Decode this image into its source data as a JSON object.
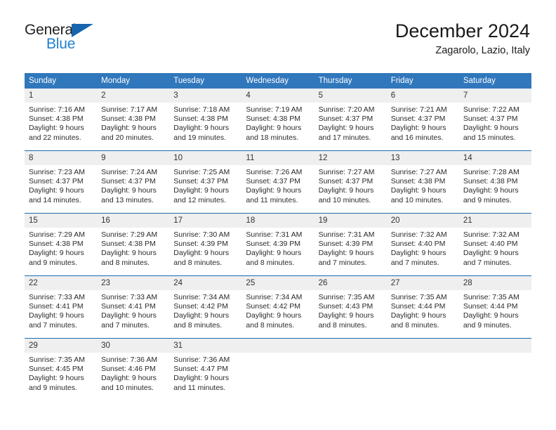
{
  "brand": {
    "name_primary": "General",
    "name_secondary": "Blue"
  },
  "header": {
    "title": "December 2024",
    "subtitle": "Zagarolo, Lazio, Italy"
  },
  "colors": {
    "header_blue": "#3077bc",
    "rule_blue": "#1c6cb0",
    "daynum_gray": "#efefef",
    "logo_blue": "#1f7fd0",
    "logo_triangle": "#1665ae"
  },
  "calendar": {
    "weekday_headers": [
      "Sunday",
      "Monday",
      "Tuesday",
      "Wednesday",
      "Thursday",
      "Friday",
      "Saturday"
    ],
    "weeks": [
      [
        {
          "day": "1",
          "sunrise": "Sunrise: 7:16 AM",
          "sunset": "Sunset: 4:38 PM",
          "daylight_line1": "Daylight: 9 hours",
          "daylight_line2": "and 22 minutes."
        },
        {
          "day": "2",
          "sunrise": "Sunrise: 7:17 AM",
          "sunset": "Sunset: 4:38 PM",
          "daylight_line1": "Daylight: 9 hours",
          "daylight_line2": "and 20 minutes."
        },
        {
          "day": "3",
          "sunrise": "Sunrise: 7:18 AM",
          "sunset": "Sunset: 4:38 PM",
          "daylight_line1": "Daylight: 9 hours",
          "daylight_line2": "and 19 minutes."
        },
        {
          "day": "4",
          "sunrise": "Sunrise: 7:19 AM",
          "sunset": "Sunset: 4:38 PM",
          "daylight_line1": "Daylight: 9 hours",
          "daylight_line2": "and 18 minutes."
        },
        {
          "day": "5",
          "sunrise": "Sunrise: 7:20 AM",
          "sunset": "Sunset: 4:37 PM",
          "daylight_line1": "Daylight: 9 hours",
          "daylight_line2": "and 17 minutes."
        },
        {
          "day": "6",
          "sunrise": "Sunrise: 7:21 AM",
          "sunset": "Sunset: 4:37 PM",
          "daylight_line1": "Daylight: 9 hours",
          "daylight_line2": "and 16 minutes."
        },
        {
          "day": "7",
          "sunrise": "Sunrise: 7:22 AM",
          "sunset": "Sunset: 4:37 PM",
          "daylight_line1": "Daylight: 9 hours",
          "daylight_line2": "and 15 minutes."
        }
      ],
      [
        {
          "day": "8",
          "sunrise": "Sunrise: 7:23 AM",
          "sunset": "Sunset: 4:37 PM",
          "daylight_line1": "Daylight: 9 hours",
          "daylight_line2": "and 14 minutes."
        },
        {
          "day": "9",
          "sunrise": "Sunrise: 7:24 AM",
          "sunset": "Sunset: 4:37 PM",
          "daylight_line1": "Daylight: 9 hours",
          "daylight_line2": "and 13 minutes."
        },
        {
          "day": "10",
          "sunrise": "Sunrise: 7:25 AM",
          "sunset": "Sunset: 4:37 PM",
          "daylight_line1": "Daylight: 9 hours",
          "daylight_line2": "and 12 minutes."
        },
        {
          "day": "11",
          "sunrise": "Sunrise: 7:26 AM",
          "sunset": "Sunset: 4:37 PM",
          "daylight_line1": "Daylight: 9 hours",
          "daylight_line2": "and 11 minutes."
        },
        {
          "day": "12",
          "sunrise": "Sunrise: 7:27 AM",
          "sunset": "Sunset: 4:37 PM",
          "daylight_line1": "Daylight: 9 hours",
          "daylight_line2": "and 10 minutes."
        },
        {
          "day": "13",
          "sunrise": "Sunrise: 7:27 AM",
          "sunset": "Sunset: 4:38 PM",
          "daylight_line1": "Daylight: 9 hours",
          "daylight_line2": "and 10 minutes."
        },
        {
          "day": "14",
          "sunrise": "Sunrise: 7:28 AM",
          "sunset": "Sunset: 4:38 PM",
          "daylight_line1": "Daylight: 9 hours",
          "daylight_line2": "and 9 minutes."
        }
      ],
      [
        {
          "day": "15",
          "sunrise": "Sunrise: 7:29 AM",
          "sunset": "Sunset: 4:38 PM",
          "daylight_line1": "Daylight: 9 hours",
          "daylight_line2": "and 9 minutes."
        },
        {
          "day": "16",
          "sunrise": "Sunrise: 7:29 AM",
          "sunset": "Sunset: 4:38 PM",
          "daylight_line1": "Daylight: 9 hours",
          "daylight_line2": "and 8 minutes."
        },
        {
          "day": "17",
          "sunrise": "Sunrise: 7:30 AM",
          "sunset": "Sunset: 4:39 PM",
          "daylight_line1": "Daylight: 9 hours",
          "daylight_line2": "and 8 minutes."
        },
        {
          "day": "18",
          "sunrise": "Sunrise: 7:31 AM",
          "sunset": "Sunset: 4:39 PM",
          "daylight_line1": "Daylight: 9 hours",
          "daylight_line2": "and 8 minutes."
        },
        {
          "day": "19",
          "sunrise": "Sunrise: 7:31 AM",
          "sunset": "Sunset: 4:39 PM",
          "daylight_line1": "Daylight: 9 hours",
          "daylight_line2": "and 7 minutes."
        },
        {
          "day": "20",
          "sunrise": "Sunrise: 7:32 AM",
          "sunset": "Sunset: 4:40 PM",
          "daylight_line1": "Daylight: 9 hours",
          "daylight_line2": "and 7 minutes."
        },
        {
          "day": "21",
          "sunrise": "Sunrise: 7:32 AM",
          "sunset": "Sunset: 4:40 PM",
          "daylight_line1": "Daylight: 9 hours",
          "daylight_line2": "and 7 minutes."
        }
      ],
      [
        {
          "day": "22",
          "sunrise": "Sunrise: 7:33 AM",
          "sunset": "Sunset: 4:41 PM",
          "daylight_line1": "Daylight: 9 hours",
          "daylight_line2": "and 7 minutes."
        },
        {
          "day": "23",
          "sunrise": "Sunrise: 7:33 AM",
          "sunset": "Sunset: 4:41 PM",
          "daylight_line1": "Daylight: 9 hours",
          "daylight_line2": "and 7 minutes."
        },
        {
          "day": "24",
          "sunrise": "Sunrise: 7:34 AM",
          "sunset": "Sunset: 4:42 PM",
          "daylight_line1": "Daylight: 9 hours",
          "daylight_line2": "and 8 minutes."
        },
        {
          "day": "25",
          "sunrise": "Sunrise: 7:34 AM",
          "sunset": "Sunset: 4:42 PM",
          "daylight_line1": "Daylight: 9 hours",
          "daylight_line2": "and 8 minutes."
        },
        {
          "day": "26",
          "sunrise": "Sunrise: 7:35 AM",
          "sunset": "Sunset: 4:43 PM",
          "daylight_line1": "Daylight: 9 hours",
          "daylight_line2": "and 8 minutes."
        },
        {
          "day": "27",
          "sunrise": "Sunrise: 7:35 AM",
          "sunset": "Sunset: 4:44 PM",
          "daylight_line1": "Daylight: 9 hours",
          "daylight_line2": "and 8 minutes."
        },
        {
          "day": "28",
          "sunrise": "Sunrise: 7:35 AM",
          "sunset": "Sunset: 4:44 PM",
          "daylight_line1": "Daylight: 9 hours",
          "daylight_line2": "and 9 minutes."
        }
      ],
      [
        {
          "day": "29",
          "sunrise": "Sunrise: 7:35 AM",
          "sunset": "Sunset: 4:45 PM",
          "daylight_line1": "Daylight: 9 hours",
          "daylight_line2": "and 9 minutes."
        },
        {
          "day": "30",
          "sunrise": "Sunrise: 7:36 AM",
          "sunset": "Sunset: 4:46 PM",
          "daylight_line1": "Daylight: 9 hours",
          "daylight_line2": "and 10 minutes."
        },
        {
          "day": "31",
          "sunrise": "Sunrise: 7:36 AM",
          "sunset": "Sunset: 4:47 PM",
          "daylight_line1": "Daylight: 9 hours",
          "daylight_line2": "and 11 minutes."
        },
        {
          "day": "",
          "sunrise": "",
          "sunset": "",
          "daylight_line1": "",
          "daylight_line2": ""
        },
        {
          "day": "",
          "sunrise": "",
          "sunset": "",
          "daylight_line1": "",
          "daylight_line2": ""
        },
        {
          "day": "",
          "sunrise": "",
          "sunset": "",
          "daylight_line1": "",
          "daylight_line2": ""
        },
        {
          "day": "",
          "sunrise": "",
          "sunset": "",
          "daylight_line1": "",
          "daylight_line2": ""
        }
      ]
    ]
  }
}
